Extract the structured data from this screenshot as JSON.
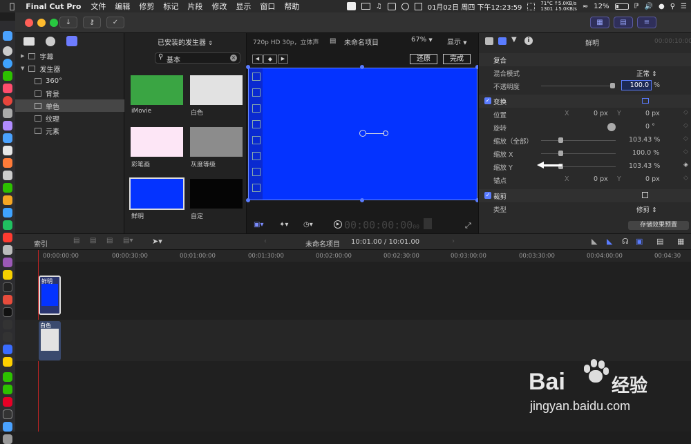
{
  "menubar": {
    "apple_icon": "apple-icon",
    "app_name": "Final Cut Pro",
    "menus": [
      "文件",
      "编辑",
      "修剪",
      "标记",
      "片段",
      "修改",
      "显示",
      "窗口",
      "帮助"
    ],
    "temp": "71°C",
    "net_up": "5.0KB/s",
    "fan": "1301",
    "net_down": "5.0KB/s",
    "battery": "12%",
    "clock": "01月02日 周四 下午12:23:59"
  },
  "browser": {
    "source_label": "已安装的发生器",
    "search_value": "基本",
    "tree": [
      {
        "label": "字幕",
        "icon": "title-icon",
        "level": 0,
        "expanded": false
      },
      {
        "label": "发生器",
        "icon": "generator-icon",
        "level": 0,
        "expanded": true
      },
      {
        "label": "360°",
        "icon": "generator-icon",
        "level": 1
      },
      {
        "label": "背景",
        "icon": "generator-icon",
        "level": 1
      },
      {
        "label": "单色",
        "icon": "generator-icon",
        "level": 1,
        "selected": true
      },
      {
        "label": "纹理",
        "icon": "generator-icon",
        "level": 1
      },
      {
        "label": "元素",
        "icon": "generator-icon",
        "level": 1
      }
    ],
    "items": [
      {
        "label": "iMovie",
        "color": "#3aa543"
      },
      {
        "label": "白色",
        "color": "#e2e2e2"
      },
      {
        "label": "彩笔画",
        "color": "#fde6f6"
      },
      {
        "label": "灰度等级",
        "color": "#8c8c8c"
      },
      {
        "label": "鲜明",
        "color": "#0433ff",
        "selected": true
      },
      {
        "label": "自定",
        "color": "#050505"
      }
    ]
  },
  "viewer": {
    "format": "720p HD 30p，立体声",
    "project": "未命名项目",
    "zoom": "67%",
    "display": "显示",
    "revert": "还原",
    "done": "完成",
    "timecode": "00:00:00:00",
    "timecode_frames": "00",
    "canvas_color": "#0433ff"
  },
  "inspector": {
    "title": "鲜明",
    "time": "00:00:10:00",
    "compositing": "复合",
    "blend_label": "混合模式",
    "blend_value": "正常",
    "opacity_label": "不透明度",
    "opacity_value": "100.0",
    "opacity_unit": "%",
    "transform": "变换",
    "position_label": "位置",
    "rotation_label": "旋转",
    "scale_all_label": "缩放（全部）",
    "scale_x_label": "缩放 X",
    "scale_y_label": "缩放 Y",
    "anchor_label": "锚点",
    "x_axis": "X",
    "y_axis": "Y",
    "pos_x": "0",
    "pos_y": "0",
    "px": "px",
    "rotation_value": "0",
    "deg": "°",
    "scale_all": "103.43",
    "scale_x": "100.0",
    "scale_y": "103.43",
    "pct": "%",
    "anchor_x": "0",
    "anchor_y": "0",
    "crop": "裁剪",
    "type_label": "类型",
    "type_value": "修剪",
    "save_preset": "存储效果预置"
  },
  "timeline": {
    "index": "索引",
    "project": "未命名项目",
    "duration": "10:01.00 / 10:01.00",
    "ruler": [
      "00:00:00:00",
      "00:00:30:00",
      "00:01:00:00",
      "00:01:30:00",
      "00:02:00:00",
      "00:02:30:00",
      "00:03:00:00",
      "00:03:30:00",
      "00:04:00:00",
      "00:04:30"
    ],
    "clips": [
      {
        "label": "鲜明",
        "color": "#0433ff"
      },
      {
        "label": "白色",
        "color": "#e2e2e2"
      }
    ]
  },
  "watermark": {
    "brand": "Bai",
    "brand_cn": "经验",
    "url": "jingyan.baidu.com"
  }
}
